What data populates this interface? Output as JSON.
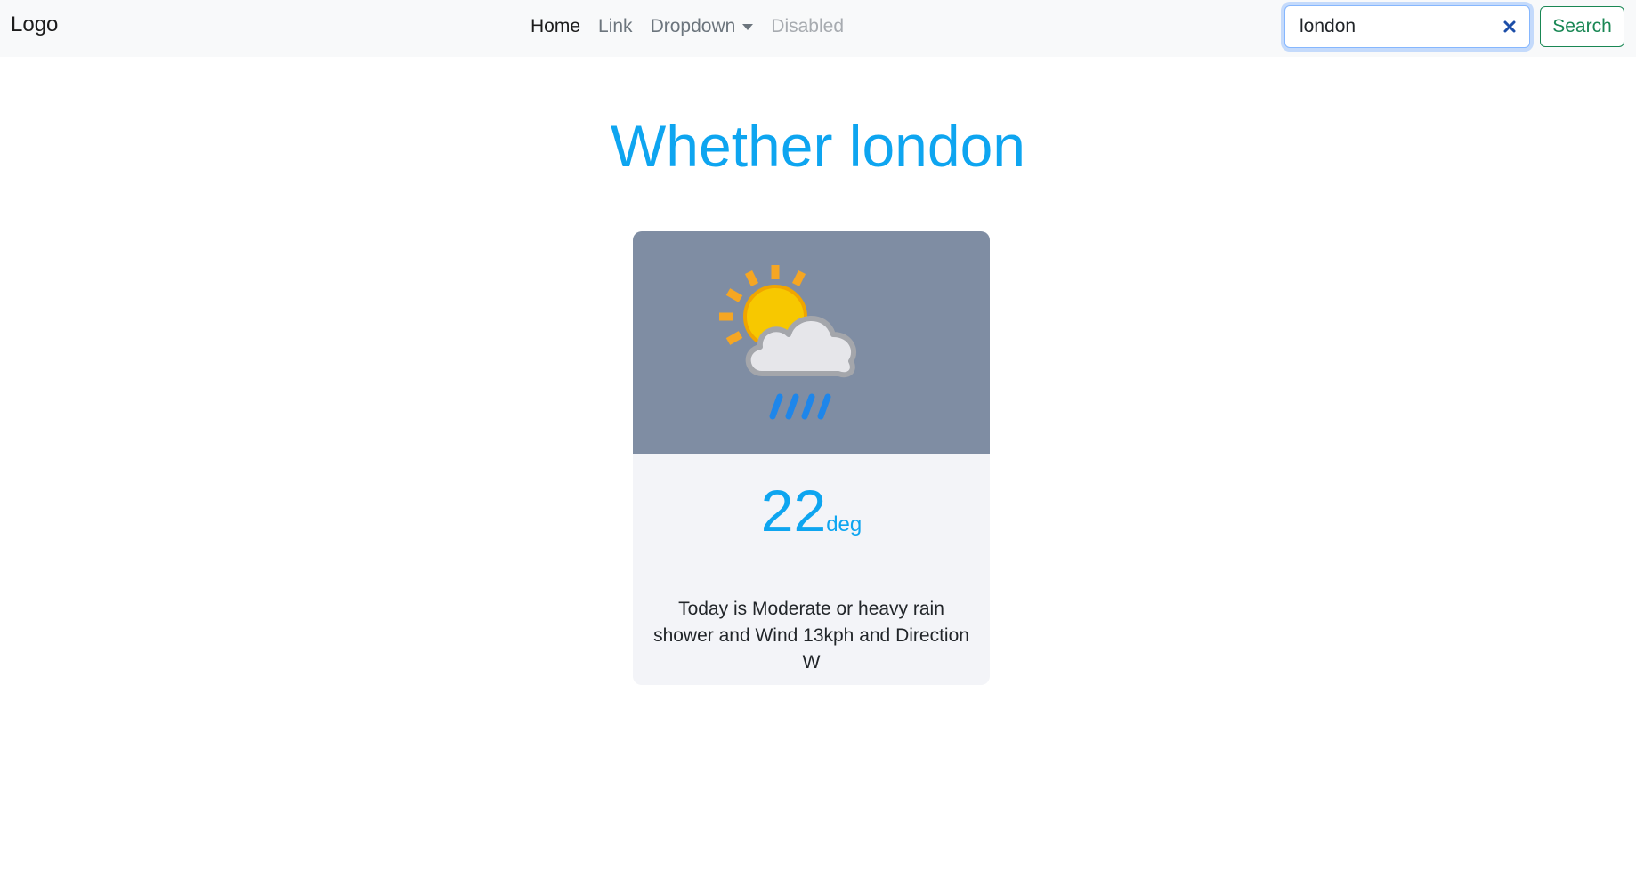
{
  "navbar": {
    "brand": "Logo",
    "links": [
      {
        "label": "Home"
      },
      {
        "label": "Link"
      },
      {
        "label": "Dropdown"
      },
      {
        "label": "Disabled"
      }
    ],
    "search": {
      "value": "london",
      "button_label": "Search"
    }
  },
  "main": {
    "title": "Whether london",
    "card": {
      "icon": "rain-shower-weather-icon",
      "temperature": "22",
      "unit": "deg",
      "description": "Today is Moderate or heavy rain shower and Wind 13kph and Direction W"
    }
  },
  "colors": {
    "accent": "#0ea5f0",
    "search_button": "#198754",
    "card_image_bg": "#7f8da3",
    "card_bg": "#f3f4f8",
    "navbar_bg": "#f8f9fa"
  }
}
